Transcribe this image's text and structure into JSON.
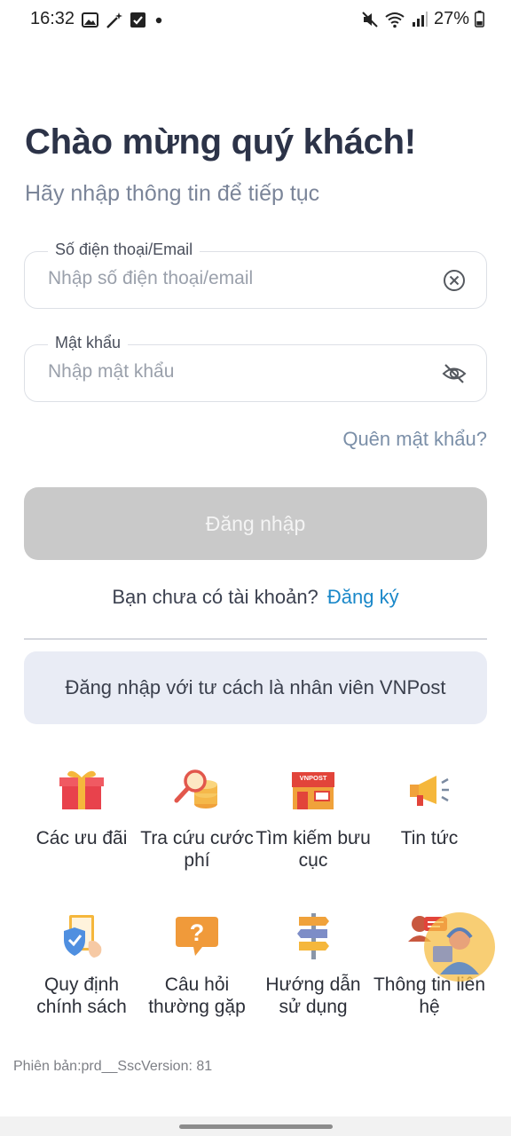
{
  "status_bar": {
    "time": "16:32",
    "left_icons": [
      "image-icon",
      "magic-wand-icon",
      "checkbox-icon",
      "dot-icon"
    ],
    "right_icons": [
      "mute-icon",
      "wifi-icon",
      "signal-icon",
      "battery-icon"
    ],
    "battery": "27%"
  },
  "header": {
    "title": "Chào mừng quý khách!",
    "subtitle": "Hãy nhập thông tin để tiếp tục"
  },
  "form": {
    "phone": {
      "label": "Số điện thoại/Email",
      "placeholder": "Nhập số điện thoại/email",
      "value": ""
    },
    "password": {
      "label": "Mật khẩu",
      "placeholder": "Nhập mật khẩu",
      "value": ""
    },
    "forgot": "Quên mật khẩu?",
    "login": "Đăng nhập",
    "register_prompt": "Bạn chưa có tài khoản?",
    "register_link": "Đăng ký",
    "staff_login": "Đăng nhập với tư cách là nhân viên VNPost"
  },
  "menu": [
    {
      "label": "Các ưu đãi",
      "icon": "gift-icon"
    },
    {
      "label": "Tra cứu cước phí",
      "icon": "search-coins-icon"
    },
    {
      "label": "Tìm kiếm bưu cục",
      "icon": "post-office-icon"
    },
    {
      "label": "Tin tức",
      "icon": "megaphone-icon"
    },
    {
      "label": "Quy định chính sách",
      "icon": "policy-document-icon"
    },
    {
      "label": "Câu hỏi thường gặp",
      "icon": "question-bubble-icon"
    },
    {
      "label": "Hướng dẫn sử dụng",
      "icon": "signpost-icon"
    },
    {
      "label": "Thông tin liên hệ",
      "icon": "contact-support-icon"
    }
  ],
  "version": "Phiên bản:prd__SscVersion: 81",
  "colors": {
    "title": "#2c3348",
    "subtitle": "#7b8599",
    "link": "#1a88c9",
    "login_disabled": "#c9c9c9",
    "staff_button_bg": "#e9ecf5"
  }
}
